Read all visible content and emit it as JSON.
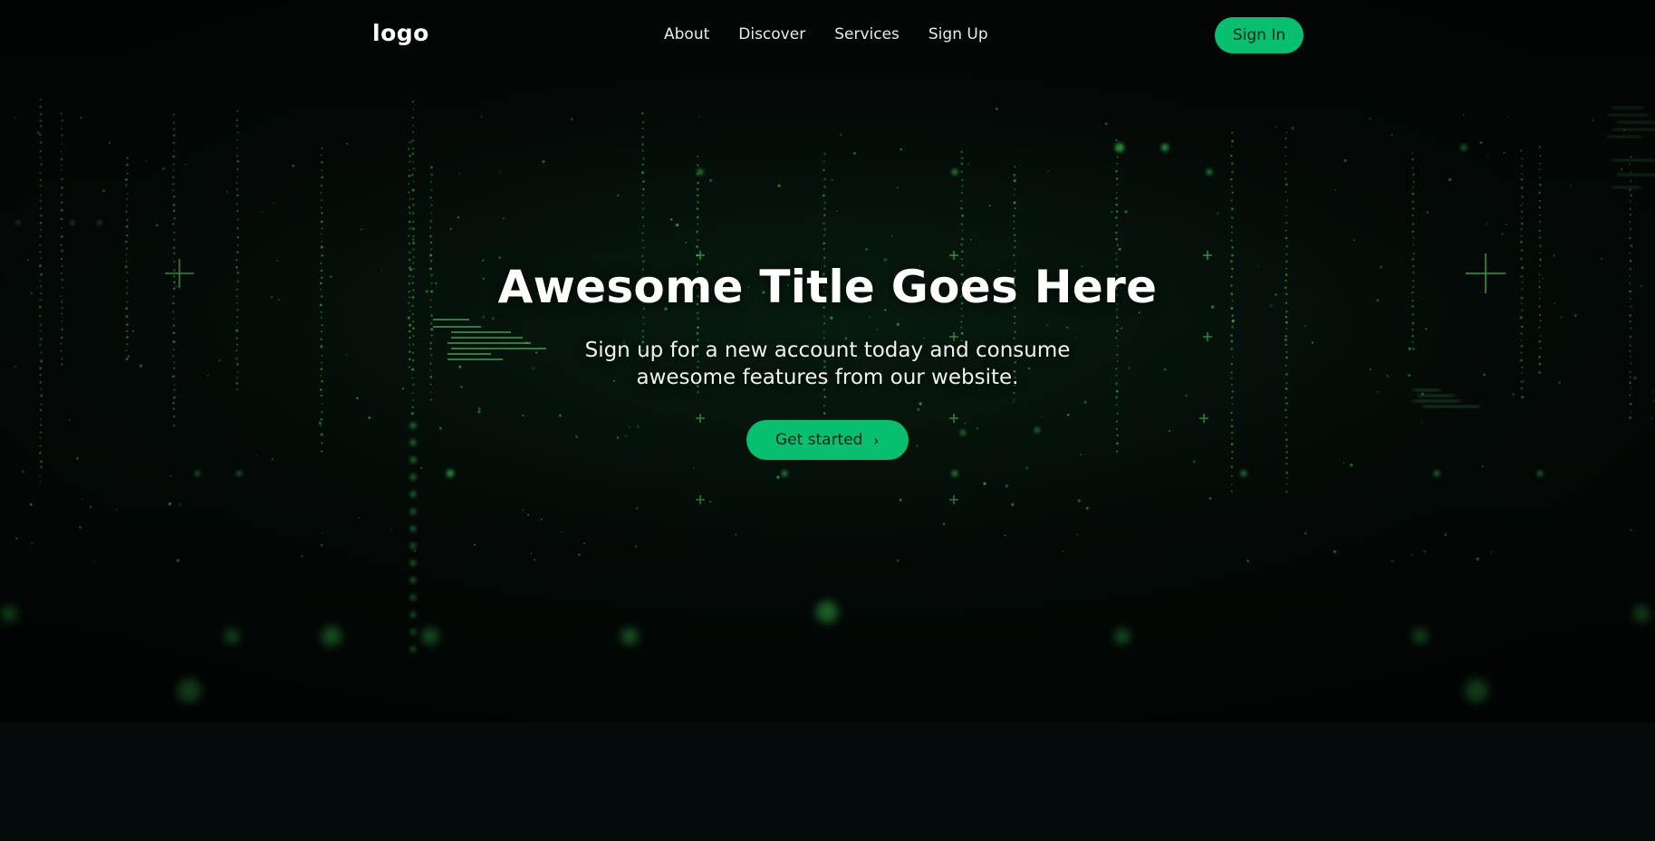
{
  "header": {
    "logo": "logo",
    "nav": [
      "About",
      "Discover",
      "Services",
      "Sign Up"
    ],
    "signin_label": "Sign In"
  },
  "hero": {
    "title": "Awesome Title Goes Here",
    "subtitle": "Sign up for a new account today and consume awesome features from our website.",
    "cta_label": "Get started",
    "cta_icon": "chevron-right-icon"
  },
  "colors": {
    "accent": "#08be6f",
    "button_text": "#0a2418",
    "background": "#030a09",
    "glow": "#3ddc5a"
  }
}
